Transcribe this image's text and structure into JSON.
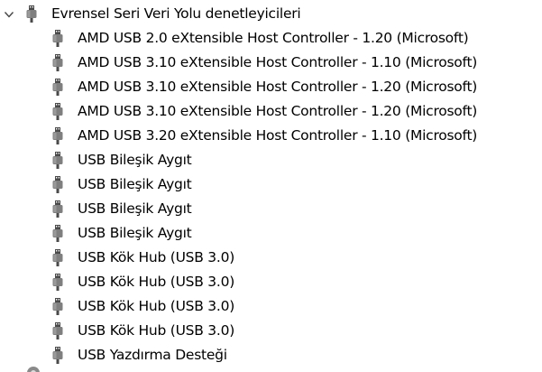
{
  "tree": {
    "category": {
      "label": "Evrensel Seri Veri Yolu denetleyicileri",
      "icon": "usb-plug-icon",
      "expanded": true
    },
    "devices": [
      {
        "label": "AMD USB 2.0 eXtensible Host Controller - 1.20 (Microsoft)",
        "icon": "usb-plug-icon"
      },
      {
        "label": "AMD USB 3.10 eXtensible Host Controller - 1.10 (Microsoft)",
        "icon": "usb-plug-icon"
      },
      {
        "label": "AMD USB 3.10 eXtensible Host Controller - 1.20 (Microsoft)",
        "icon": "usb-plug-icon"
      },
      {
        "label": "AMD USB 3.10 eXtensible Host Controller - 1.20 (Microsoft)",
        "icon": "usb-plug-icon"
      },
      {
        "label": "AMD USB 3.20 eXtensible Host Controller - 1.10 (Microsoft)",
        "icon": "usb-plug-icon"
      },
      {
        "label": "USB Bileşik Aygıt",
        "icon": "usb-plug-icon"
      },
      {
        "label": "USB Bileşik Aygıt",
        "icon": "usb-plug-icon"
      },
      {
        "label": "USB Bileşik Aygıt",
        "icon": "usb-plug-icon"
      },
      {
        "label": "USB Bileşik Aygıt",
        "icon": "usb-plug-icon"
      },
      {
        "label": "USB Kök Hub (USB 3.0)",
        "icon": "usb-plug-icon"
      },
      {
        "label": "USB Kök Hub (USB 3.0)",
        "icon": "usb-plug-icon"
      },
      {
        "label": "USB Kök Hub (USB 3.0)",
        "icon": "usb-plug-icon"
      },
      {
        "label": "USB Kök Hub (USB 3.0)",
        "icon": "usb-plug-icon"
      },
      {
        "label": "USB Yazdırma Desteği",
        "icon": "usb-plug-icon"
      }
    ],
    "next_category_icon": "device-category-icon"
  },
  "colors": {
    "icon_body": "#7f7f7f",
    "icon_dark": "#4a4a4a",
    "text": "#000000"
  }
}
